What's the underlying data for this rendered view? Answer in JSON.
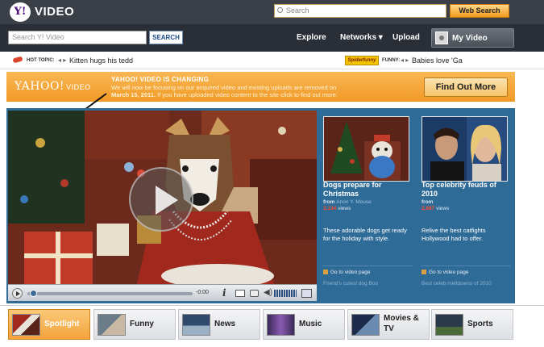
{
  "header": {
    "logo_mark": "Y!",
    "logo_text": "VIDEO",
    "search_placeholder": "Search",
    "web_search_label": "Web Search"
  },
  "nav": {
    "video_search_placeholder": "Search Y! Video",
    "video_search_button": "SEARCH",
    "explore": "Explore",
    "networks": "Networks ▾",
    "upload": "Upload",
    "my_video": "My Video"
  },
  "hot_strip": {
    "hot_label": "HOT TOPIC:",
    "hot_arrows": "◂ ▸",
    "hot_text": "Kitten hugs his tedd",
    "funny_badge": "Spiderfunny",
    "funny_label": "FUNNY:",
    "funny_arrows": "◂ ▸",
    "funny_text": "Babies love 'Ga"
  },
  "banner": {
    "logo": "YAHOO!",
    "logo_video": "VIDEO",
    "title": "YAHOO! VIDEO IS CHANGING",
    "line1": "We will now be focusing on our acquired video and existing uploads are removed on",
    "line2_date": "March 15, 2011.",
    "line2_rest": "If you have uploaded video content to the site click to find out more.",
    "button": "Find Out More"
  },
  "player": {
    "time": "-0:00",
    "info_icon": "i"
  },
  "cards": [
    {
      "title": "Dogs prepare for Christmas",
      "from_label": "from",
      "from_name": "Anon Y. Mouse",
      "views_count": "3,134",
      "views_label": "views",
      "description": "These adorable dogs get ready for the holiday with style.",
      "goto": "Go to video page",
      "related": "Friend's cutest dog Boo"
    },
    {
      "title": "Top celebrity feuds of 2010",
      "from_label": "from",
      "from_name": "",
      "views_count": "2,987",
      "views_label": "views",
      "description": "Relive the best catfights Hollywood had to offer.",
      "goto": "Go to video page",
      "related": "Best celeb meltdowns of 2010"
    }
  ],
  "tabs": [
    {
      "label": "Spotlight",
      "active": true
    },
    {
      "label": "Funny",
      "active": false
    },
    {
      "label": "News",
      "active": false
    },
    {
      "label": "Music",
      "active": false
    },
    {
      "label": "Movies & TV",
      "active": false
    },
    {
      "label": "Sports",
      "active": false
    }
  ],
  "colors": {
    "top_bar": "#3a3f48",
    "nav_bar": "#2a2f37",
    "banner": "#f19a26",
    "panel_blue": "#2f6b97",
    "views_red": "#ff4a2a",
    "active_tab": "#f3a33c"
  }
}
